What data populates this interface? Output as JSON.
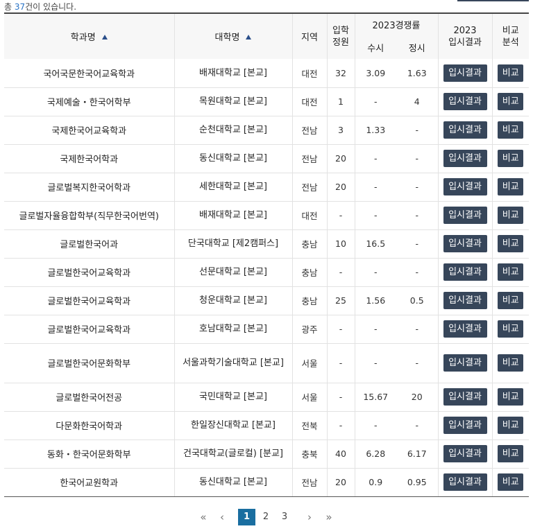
{
  "summary": {
    "prefix": "총 ",
    "count": "37",
    "suffix": "건이 있습니다."
  },
  "columns": {
    "dept": "학과명",
    "univ": "대학명",
    "region": "지역",
    "quota_line1": "입학",
    "quota_line2": "정원",
    "rate_group": "2023경쟁률",
    "rate_early": "수시",
    "rate_regular": "정시",
    "result_line1": "2023",
    "result_line2": "입시결과",
    "compare_line1": "비교",
    "compare_line2": "분석"
  },
  "buttons": {
    "result": "입시결과",
    "compare": "비교"
  },
  "rows": [
    {
      "dept": "국어국문한국어교육학과",
      "univ": "배재대학교 [본교]",
      "region": "대전",
      "quota": "32",
      "early": "3.09",
      "regular": "1.63"
    },
    {
      "dept": "국제예술・한국어학부",
      "univ": "목원대학교 [본교]",
      "region": "대전",
      "quota": "1",
      "early": "-",
      "regular": "4"
    },
    {
      "dept": "국제한국어교육학과",
      "univ": "순천대학교 [본교]",
      "region": "전남",
      "quota": "3",
      "early": "1.33",
      "regular": "-"
    },
    {
      "dept": "국제한국어학과",
      "univ": "동신대학교 [본교]",
      "region": "전남",
      "quota": "20",
      "early": "-",
      "regular": "-"
    },
    {
      "dept": "글로벌복지한국어학과",
      "univ": "세한대학교 [본교]",
      "region": "전남",
      "quota": "20",
      "early": "-",
      "regular": "-"
    },
    {
      "dept": "글로벌자율융합학부(직무한국어번역)",
      "univ": "배재대학교 [본교]",
      "region": "대전",
      "quota": "-",
      "early": "-",
      "regular": "-"
    },
    {
      "dept": "글로벌한국어과",
      "univ": "단국대학교 [제2캠퍼스]",
      "region": "충남",
      "quota": "10",
      "early": "16.5",
      "regular": "-"
    },
    {
      "dept": "글로벌한국어교육학과",
      "univ": "선문대학교 [본교]",
      "region": "충남",
      "quota": "-",
      "early": "-",
      "regular": "-"
    },
    {
      "dept": "글로벌한국어교육학과",
      "univ": "청운대학교 [본교]",
      "region": "충남",
      "quota": "25",
      "early": "1.56",
      "regular": "0.5"
    },
    {
      "dept": "글로벌한국어교육학과",
      "univ": "호남대학교 [본교]",
      "region": "광주",
      "quota": "-",
      "early": "-",
      "regular": "-"
    },
    {
      "dept": "글로벌한국어문화학부",
      "univ": "서울과학기술대학교 [본교]",
      "region": "서울",
      "quota": "-",
      "early": "-",
      "regular": "-"
    },
    {
      "dept": "글로벌한국어전공",
      "univ": "국민대학교 [본교]",
      "region": "서울",
      "quota": "-",
      "early": "15.67",
      "regular": "20"
    },
    {
      "dept": "다문화한국어학과",
      "univ": "한일장신대학교 [본교]",
      "region": "전북",
      "quota": "-",
      "early": "-",
      "regular": "-"
    },
    {
      "dept": "동화・한국어문화학부",
      "univ": "건국대학교(글로컬) [분교]",
      "region": "충북",
      "quota": "40",
      "early": "6.28",
      "regular": "6.17"
    },
    {
      "dept": "한국어교원학과",
      "univ": "동신대학교 [본교]",
      "region": "전남",
      "quota": "20",
      "early": "0.9",
      "regular": "0.95"
    }
  ],
  "pagination": {
    "first": "«",
    "prev": "‹",
    "next": "›",
    "last": "»",
    "pages": [
      "1",
      "2",
      "3"
    ],
    "current": "1"
  }
}
